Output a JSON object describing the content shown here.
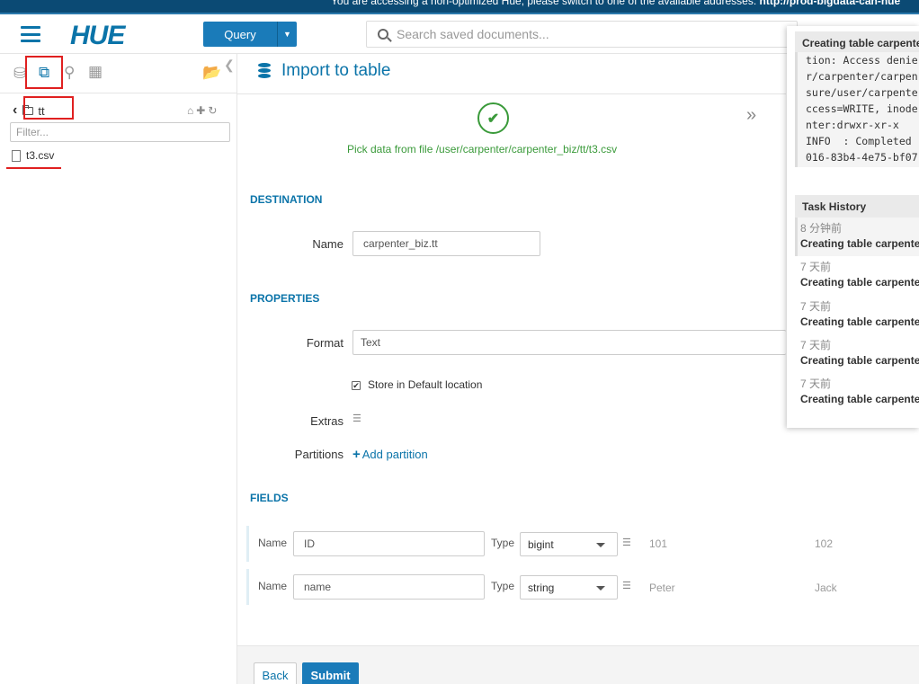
{
  "banner": {
    "text": "You are accessing a non-optimized Hue, please switch to one of the available addresses: ",
    "link": "http://prod-bigdata-can-hue"
  },
  "header": {
    "logo": "HUE",
    "query_button": "Query",
    "search_placeholder": "Search saved documents..."
  },
  "left_panel": {
    "breadcrumb": "tt",
    "filter_placeholder": "Filter...",
    "files": [
      "t3.csv"
    ]
  },
  "main": {
    "title": "Import to table",
    "pick_message": "Pick data from file /user/carpenter/carpenter_biz/tt/t3.csv",
    "destination": {
      "heading": "DESTINATION",
      "name_label": "Name",
      "name_value": "carpenter_biz.tt"
    },
    "properties": {
      "heading": "PROPERTIES",
      "format_label": "Format",
      "format_value": "Text",
      "store_default_label": "Store in Default location",
      "store_default_checked": true,
      "extras_label": "Extras",
      "partitions_label": "Partitions",
      "add_partition": "Add partition"
    },
    "fields": {
      "heading": "FIELDS",
      "name_label": "Name",
      "type_label": "Type",
      "rows": [
        {
          "name": "ID",
          "type": "bigint",
          "samples": [
            "101",
            "102"
          ]
        },
        {
          "name": "name",
          "type": "string",
          "samples": [
            "Peter",
            "Jack"
          ]
        }
      ]
    },
    "buttons": {
      "back": "Back",
      "submit": "Submit"
    }
  },
  "jobs_panel": {
    "current_title": "Creating table carpenter",
    "log_lines": [
      "tion: Access denie",
      "r/carpenter/carpen",
      "sure/user/carpente",
      "ccess=WRITE, inode",
      "nter:drwxr-xr-x",
      "INFO  : Completed",
      "016-83b4-4e75-bf07"
    ],
    "history_title": "Task History",
    "history": [
      {
        "time": "8 分钟前",
        "name": "Creating table carpenter_"
      },
      {
        "time": "7 天前",
        "name": "Creating table carpenter_"
      },
      {
        "time": "7 天前",
        "name": "Creating table carpenter_"
      },
      {
        "time": "7 天前",
        "name": "Creating table carpenter_"
      },
      {
        "time": "7 天前",
        "name": "Creating table carpenter_"
      }
    ]
  },
  "colors": {
    "primary": "#0b74a9",
    "success": "#3a9a3a",
    "highlight": "#e02020"
  }
}
